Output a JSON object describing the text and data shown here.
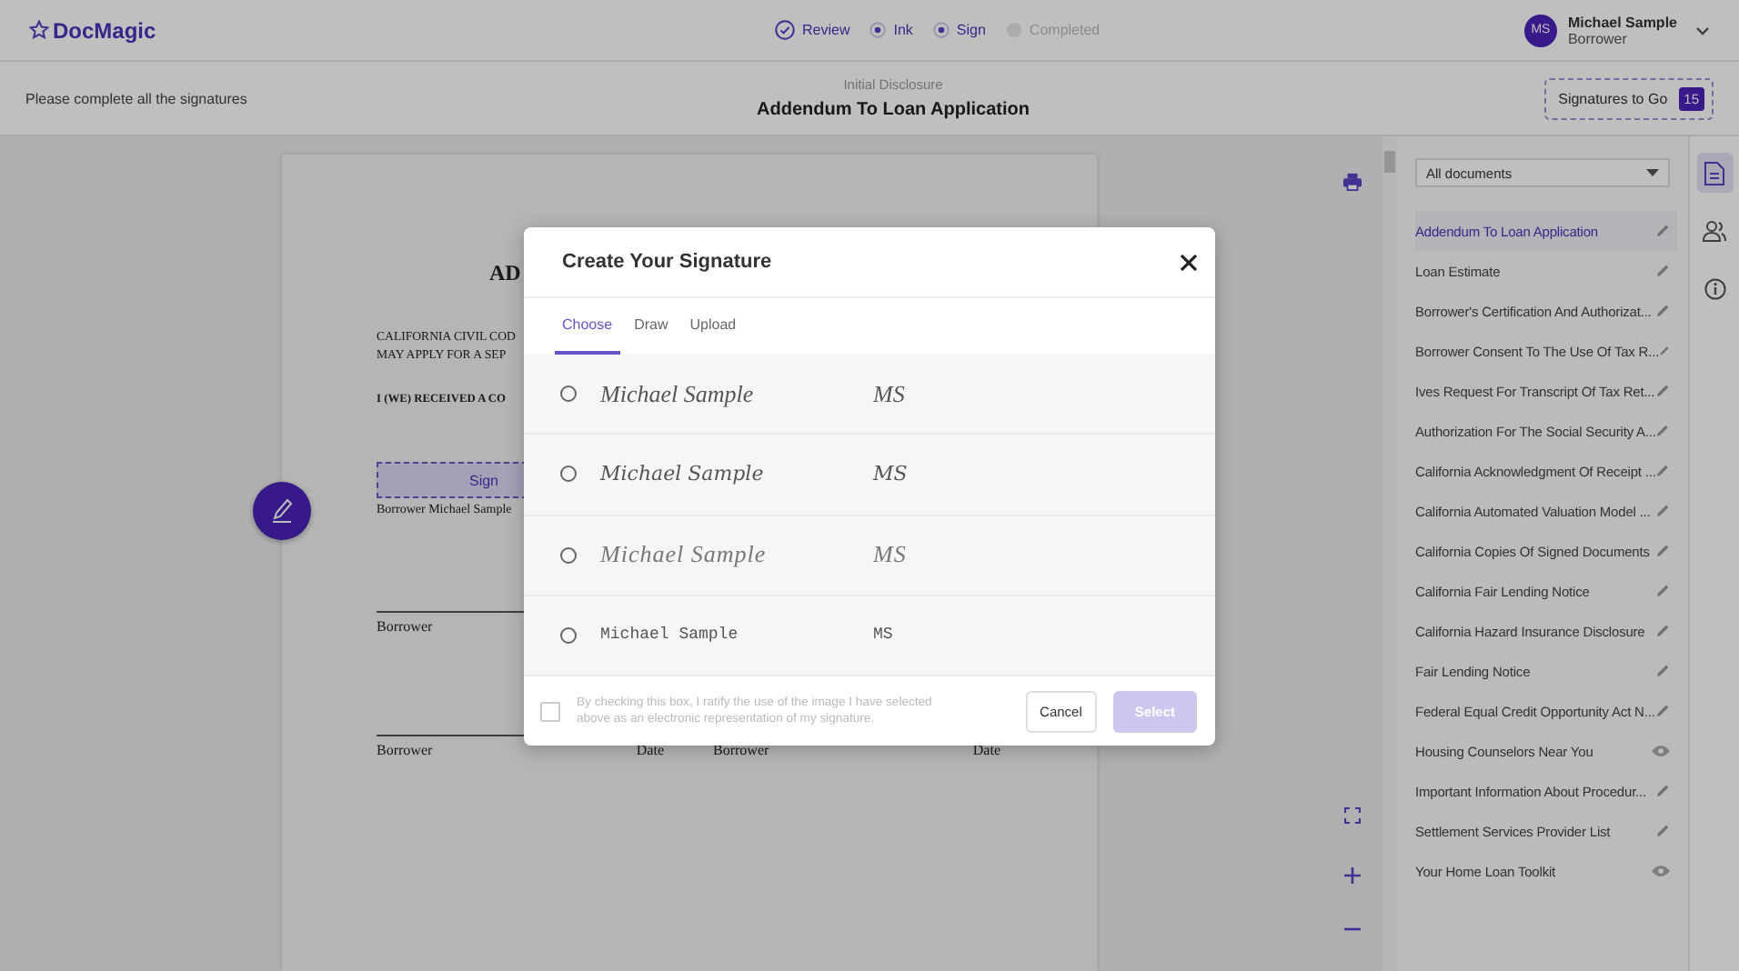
{
  "header": {
    "logo": "DocMagic",
    "steps": [
      {
        "label": "Review",
        "done": true,
        "disabled": false
      },
      {
        "label": "Ink",
        "done": false,
        "disabled": false
      },
      {
        "label": "Sign",
        "done": false,
        "disabled": false
      },
      {
        "label": "Completed",
        "done": false,
        "disabled": true
      }
    ],
    "user": {
      "initials": "MS",
      "name": "Michael Sample",
      "role": "Borrower"
    }
  },
  "subheader": {
    "instruction": "Please complete all the signatures",
    "category": "Initial Disclosure",
    "title": "Addendum To Loan Application",
    "counter_label": "Signatures to Go",
    "counter": "15"
  },
  "document": {
    "heading": "AD",
    "lines": [
      "CALIFORNIA CIVIL COD",
      "MAY APPLY FOR A SEP"
    ],
    "statement": "I (WE) RECEIVED A CO",
    "sign_label": "Sign",
    "signer": "Borrower Michael Sample",
    "line_1_label": "Borrower",
    "line_2": [
      {
        "label": "Borrower",
        "date": "Date"
      },
      {
        "label": "Borrower",
        "date": "Date"
      }
    ]
  },
  "sidebar": {
    "filter": "All documents",
    "items": [
      {
        "label": "Addendum To Loan Application",
        "selected": true,
        "kind": "edit"
      },
      {
        "label": "Loan Estimate",
        "selected": false,
        "kind": "edit"
      },
      {
        "label": "Borrower's Certification And Authorizat...",
        "selected": false,
        "kind": "edit"
      },
      {
        "label": "Borrower Consent To The Use Of Tax R...",
        "selected": false,
        "kind": "edit"
      },
      {
        "label": "Ives Request For Transcript Of Tax Ret...",
        "selected": false,
        "kind": "edit"
      },
      {
        "label": "Authorization For The Social Security A...",
        "selected": false,
        "kind": "edit"
      },
      {
        "label": "California Acknowledgment Of Receipt ...",
        "selected": false,
        "kind": "edit"
      },
      {
        "label": "California Automated Valuation Model ...",
        "selected": false,
        "kind": "edit"
      },
      {
        "label": "California Copies Of Signed Documents",
        "selected": false,
        "kind": "edit"
      },
      {
        "label": "California Fair Lending Notice",
        "selected": false,
        "kind": "edit"
      },
      {
        "label": "California Hazard Insurance Disclosure",
        "selected": false,
        "kind": "edit"
      },
      {
        "label": "Fair Lending Notice",
        "selected": false,
        "kind": "edit"
      },
      {
        "label": "Federal Equal Credit Opportunity Act N...",
        "selected": false,
        "kind": "edit"
      },
      {
        "label": "Housing Counselors Near You",
        "selected": false,
        "kind": "view"
      },
      {
        "label": "Important Information About Procedur...",
        "selected": false,
        "kind": "edit"
      },
      {
        "label": "Settlement Services Provider List",
        "selected": false,
        "kind": "edit"
      },
      {
        "label": "Your Home Loan Toolkit",
        "selected": false,
        "kind": "view"
      }
    ]
  },
  "rail": [
    {
      "kind": "documents",
      "selected": true
    },
    {
      "kind": "participants",
      "selected": false
    },
    {
      "kind": "info",
      "selected": false
    }
  ],
  "modal": {
    "title": "Create Your Signature",
    "tabs": [
      {
        "label": "Choose",
        "selected": true
      },
      {
        "label": "Draw",
        "selected": false
      },
      {
        "label": "Upload",
        "selected": false
      }
    ],
    "signatures": [
      {
        "name": "Michael Sample",
        "initials": "MS",
        "selected": false
      },
      {
        "name": "Michael Sample",
        "initials": "MS",
        "selected": false
      },
      {
        "name": "Michael Sample",
        "initials": "MS",
        "selected": false
      },
      {
        "name": "Michael Sample",
        "initials": "MS",
        "selected": false
      }
    ],
    "consent": {
      "text": "By checking this box, I ratify the use of the image I have selected above as an electronic representation of my signature.",
      "checked": false
    },
    "cancel": "Cancel",
    "select": {
      "label": "Select",
      "disabled": true
    }
  }
}
